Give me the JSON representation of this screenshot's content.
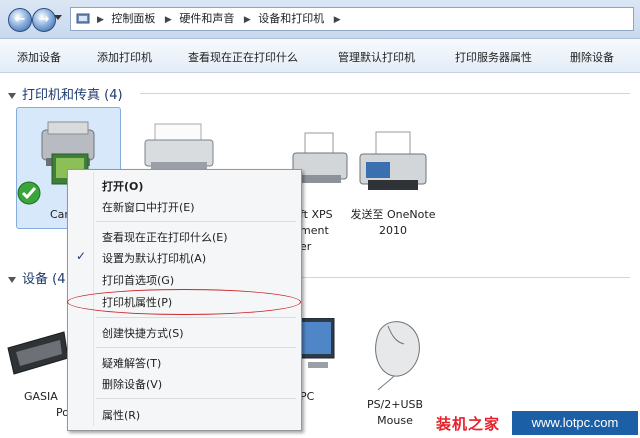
{
  "address_bar": {
    "back_label": "←",
    "forward_label": "→",
    "breadcrumbs": [
      "控制面板",
      "硬件和声音",
      "设备和打印机"
    ]
  },
  "toolbar": {
    "items": [
      "添加设备",
      "添加打印机",
      "查看现在正在打印什么",
      "管理默认打印机",
      "打印服务器属性",
      "删除设备"
    ]
  },
  "groups": {
    "printers": {
      "title": "打印机和传真 (4)"
    },
    "devices": {
      "title": "设备 (4"
    }
  },
  "printers": [
    {
      "label": "Car"
    },
    {
      "label": ""
    },
    {
      "label_lines": [
        "ft XPS",
        "ment",
        "er"
      ]
    },
    {
      "label_lines": [
        "发送至 OneNote",
        "2010"
      ]
    }
  ],
  "devices": [
    {
      "label_lines": [
        "GASIA",
        "Po"
      ]
    },
    {
      "label": "-PC"
    },
    {
      "label_lines": [
        "PS/2+USB",
        "Mouse"
      ]
    }
  ],
  "context_menu": {
    "items": [
      {
        "label": "打开(O)",
        "bold": true
      },
      {
        "label": "在新窗口中打开(E)"
      },
      {
        "label": "查看现在正在打印什么(E)"
      },
      {
        "label": "设置为默认打印机(A)",
        "checked": true
      },
      {
        "label": "打印首选项(G)"
      },
      {
        "label": "打印机属性(P)",
        "highlighted": true
      },
      {
        "label": "创建快捷方式(S)"
      },
      {
        "label": "疑难解答(T)"
      },
      {
        "label": "删除设备(V)"
      },
      {
        "label": "属性(R)"
      }
    ],
    "check_glyph": "✓"
  },
  "watermark": {
    "cn": "装机之家",
    "url": "www.lotpc.com"
  },
  "colors": {
    "accent": "#1e3a6e",
    "highlight_ellipse": "#c8262b",
    "watermark_red": "#e8202a",
    "watermark_blue": "#1b5fa6"
  }
}
